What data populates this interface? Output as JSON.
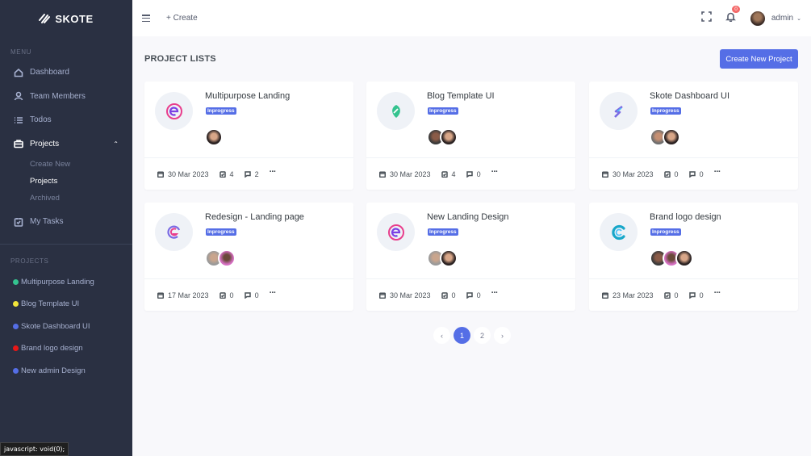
{
  "brand": {
    "name": "SKOTE"
  },
  "sidebar": {
    "menu_title": "MENU",
    "items": [
      {
        "label": "Dashboard",
        "icon": "home-icon"
      },
      {
        "label": "Team Members",
        "icon": "user-icon"
      },
      {
        "label": "Todos",
        "icon": "list-icon"
      },
      {
        "label": "Projects",
        "icon": "briefcase-icon"
      },
      {
        "label": "My Tasks",
        "icon": "task-icon"
      }
    ],
    "sub_items": [
      "Create New",
      "Projects",
      "Archived"
    ],
    "projects_title": "PROJECTS",
    "projects": [
      {
        "label": "Multipurpose Landing",
        "color": "#34c38f"
      },
      {
        "label": "Blog Template UI",
        "color": "#f1e43a"
      },
      {
        "label": "Skote Dashboard UI",
        "color": "#556ee6"
      },
      {
        "label": "Brand logo design",
        "color": "#e81717"
      },
      {
        "label": "New admin Design",
        "color": "#556ee6"
      }
    ]
  },
  "topbar": {
    "create_label": "+ Create",
    "notification_count": "0",
    "user_name": "admin"
  },
  "main": {
    "page_title": "PROJECT LISTS",
    "create_button": "Create New Project",
    "projects": [
      {
        "title": "Multipurpose Landing",
        "status": "Inprogress",
        "date": "30 Mar 2023",
        "tasks": "4",
        "comments": "2",
        "logo": "e-logo-icon",
        "members": 1
      },
      {
        "title": "Blog Template UI",
        "status": "Inprogress",
        "date": "30 Mar 2023",
        "tasks": "4",
        "comments": "0",
        "logo": "leaf-logo-icon",
        "members": 2
      },
      {
        "title": "Skote Dashboard UI",
        "status": "Inprogress",
        "date": "30 Mar 2023",
        "tasks": "0",
        "comments": "0",
        "logo": "s-logo-icon",
        "members": 2
      },
      {
        "title": "Redesign - Landing page",
        "status": "Inprogress",
        "date": "17 Mar 2023",
        "tasks": "0",
        "comments": "0",
        "logo": "swirl-logo-icon",
        "members": 2
      },
      {
        "title": "New Landing Design",
        "status": "Inprogress",
        "date": "30 Mar 2023",
        "tasks": "0",
        "comments": "0",
        "logo": "e-logo-icon",
        "members": 2
      },
      {
        "title": "Brand logo design",
        "status": "Inprogress",
        "date": "23 Mar 2023",
        "tasks": "0",
        "comments": "0",
        "logo": "c-logo-icon",
        "members": 3
      }
    ]
  },
  "pagination": {
    "prev": "‹",
    "pages": [
      "1",
      "2"
    ],
    "next": "›",
    "active": "1"
  },
  "status_tip": "javascript: void(0);",
  "colors": {
    "sidebar": "#2a3042",
    "accent": "#556ee6"
  }
}
